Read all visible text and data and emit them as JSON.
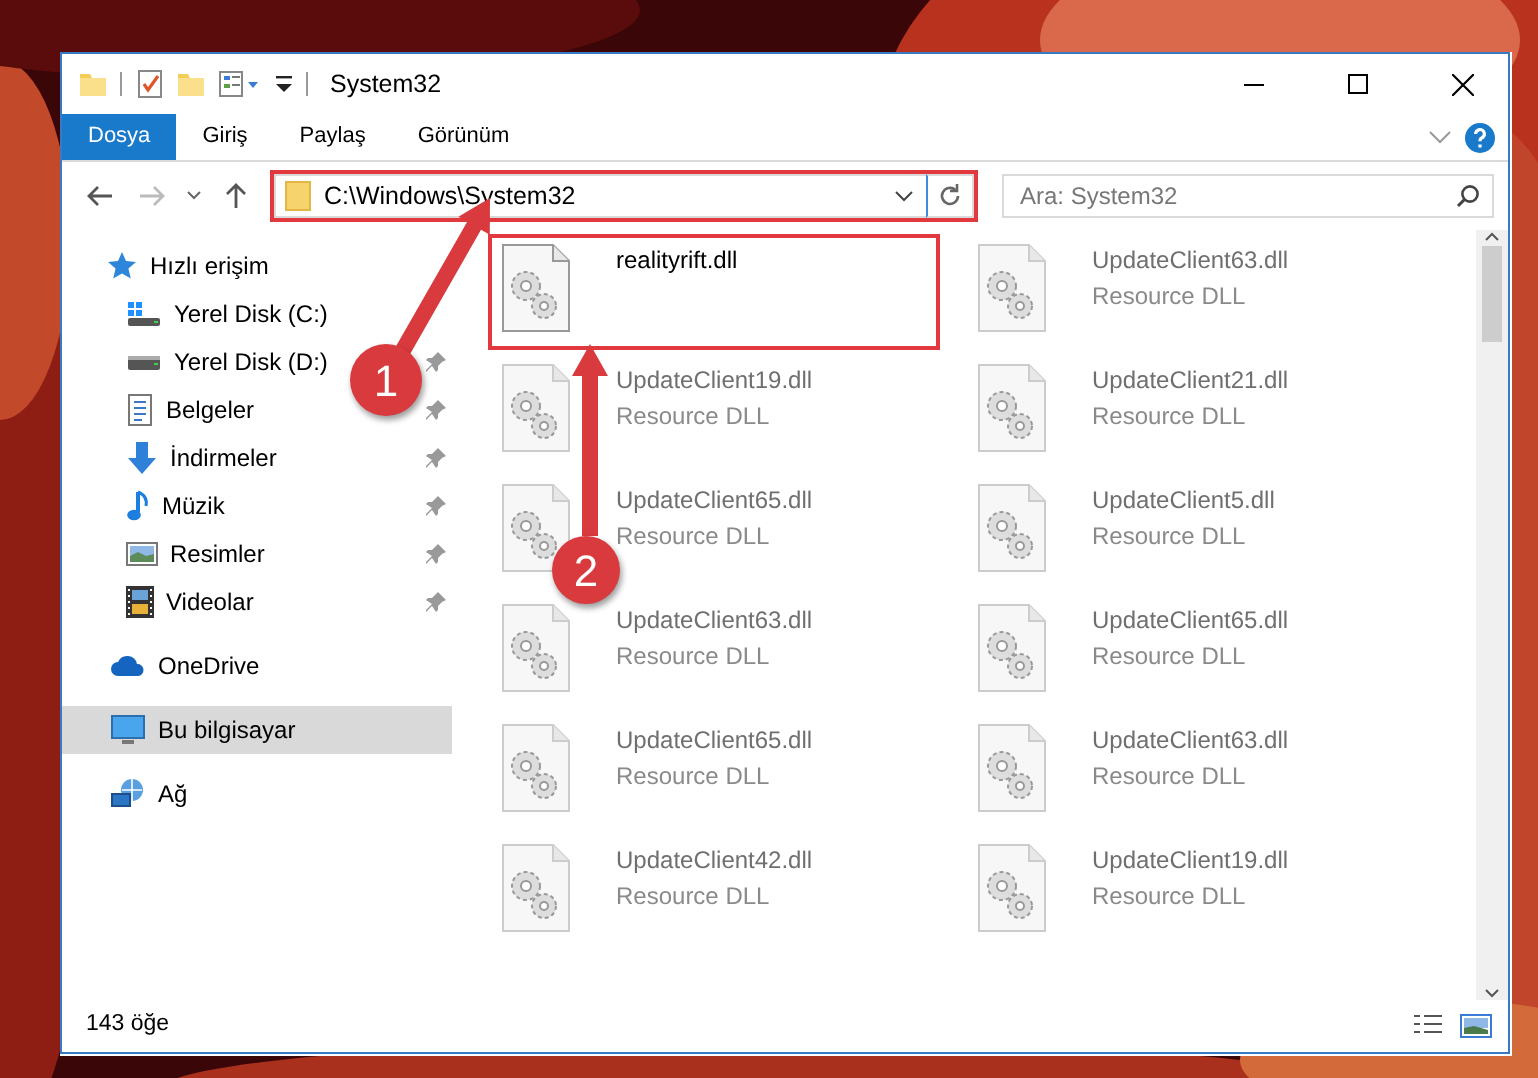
{
  "window": {
    "title": "System32"
  },
  "ribbon_tabs": [
    {
      "label": "Dosya",
      "selected": true
    },
    {
      "label": "Giriş",
      "selected": false
    },
    {
      "label": "Paylaş",
      "selected": false
    },
    {
      "label": "Görünüm",
      "selected": false
    }
  ],
  "address": {
    "path": "C:\\Windows\\System32",
    "highlighted": true
  },
  "search": {
    "placeholder": "Ara: System32"
  },
  "nav": [
    {
      "label": "Hızlı erişim",
      "kind": "star",
      "selected": false,
      "children": [
        {
          "label": "Yerel Disk (C:)",
          "kind": "system-drive",
          "pinned": false,
          "selected": false
        },
        {
          "label": "Yerel Disk (D:)",
          "kind": "drive",
          "pinned": true,
          "selected": false
        },
        {
          "label": "Belgeler",
          "kind": "documents",
          "pinned": true,
          "selected": false
        },
        {
          "label": "İndirmeler",
          "kind": "downloads",
          "pinned": true,
          "selected": false
        },
        {
          "label": "Müzik",
          "kind": "music",
          "pinned": true,
          "selected": false
        },
        {
          "label": "Resimler",
          "kind": "pictures",
          "pinned": true,
          "selected": false
        },
        {
          "label": "Videolar",
          "kind": "videos",
          "pinned": true,
          "selected": false
        }
      ]
    },
    {
      "label": "OneDrive",
      "kind": "cloud",
      "selected": false
    },
    {
      "label": "Bu bilgisayar",
      "kind": "computer",
      "selected": true
    },
    {
      "label": "Ağ",
      "kind": "network",
      "selected": false
    }
  ],
  "files": [
    {
      "name": "realityrift.dll",
      "blurred": false,
      "highlighted": true
    },
    {
      "name": "UpdateClient63.dll",
      "type": "Resource DLL",
      "blurred": true,
      "highlighted": false
    },
    {
      "name": "UpdateClient19.dll",
      "type": "Resource DLL",
      "blurred": true,
      "highlighted": false
    },
    {
      "name": "UpdateClient21.dll",
      "type": "Resource DLL",
      "blurred": true,
      "highlighted": false
    },
    {
      "name": "UpdateClient65.dll",
      "type": "Resource DLL",
      "blurred": true,
      "highlighted": false
    },
    {
      "name": "UpdateClient5.dll",
      "type": "Resource DLL",
      "blurred": true,
      "highlighted": false
    },
    {
      "name": "UpdateClient63.dll",
      "type": "Resource DLL",
      "blurred": true,
      "highlighted": false
    },
    {
      "name": "UpdateClient65.dll",
      "type": "Resource DLL",
      "blurred": true,
      "highlighted": false
    },
    {
      "name": "UpdateClient65.dll",
      "type": "Resource DLL",
      "blurred": true,
      "highlighted": false
    },
    {
      "name": "UpdateClient63.dll",
      "type": "Resource DLL",
      "blurred": true,
      "highlighted": false
    },
    {
      "name": "UpdateClient42.dll",
      "type": "Resource DLL",
      "blurred": true,
      "highlighted": false
    },
    {
      "name": "UpdateClient19.dll",
      "type": "Resource DLL",
      "blurred": true,
      "highlighted": false
    }
  ],
  "status_bar": {
    "count": "143 öğe"
  },
  "annotations": [
    {
      "number": "1"
    },
    {
      "number": "2"
    }
  ]
}
